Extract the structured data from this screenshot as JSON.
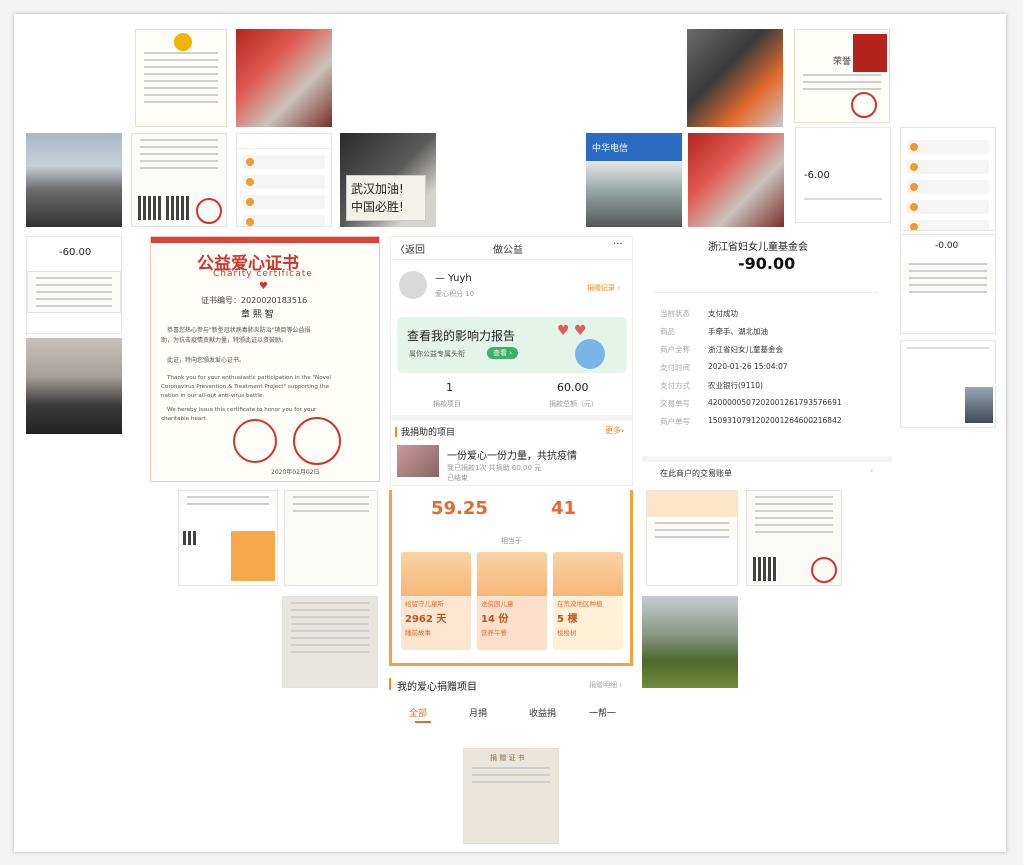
{
  "certificate": {
    "title": "公益爱心证书",
    "subtitle": "Charity certificate",
    "number": "证书编号：2020020183516",
    "name": "章 熙 智",
    "body_cn_1": "恭喜您热心参与\"新型冠状病毒肺炎防治\"项目等公益捐",
    "body_cn_2": "助，为抗击疫情贡献力量，特颁此证以资鼓励。",
    "body_cn_3": "此证，特向您颁发爱心证书。",
    "body_en_1": "Thank you for your enthusiastic participation in the \"Novel",
    "body_en_2": "Coronavirus Prevention & Treatment Project\" supporting the",
    "body_en_3": "nation in our all-out anti-virus battle.",
    "body_en_4": "We hereby issue this certificate to honor you for your",
    "body_en_5": "charitable heart.",
    "date": "2020年02月02日"
  },
  "app": {
    "back_label": "返回",
    "title": "做公益",
    "more": "···",
    "user_name": "— Yuyh",
    "user_sub": "爱心积分 10",
    "user_link": "捐赠记录",
    "banner_title": "查看我的影响力报告",
    "banner_sub": "属你公益专属头衔",
    "banner_btn": "查看",
    "stat1_value": "1",
    "stat1_label": "捐款项目",
    "stat2_value": "60.00",
    "stat2_label": "捐款总额（元）",
    "section_title": "我捐助的项目",
    "section_more": "更多",
    "project_title": "一份爱心一份力量，共抗疫情",
    "project_sub1": "我已捐款1次 共捐助 60.00 元",
    "project_sub2": "已结束"
  },
  "payment": {
    "merchant": "浙江省妇女儿童基金会",
    "amount": "-90.00",
    "rows": [
      {
        "label": "当前状态",
        "value": "支付成功"
      },
      {
        "label": "商品",
        "value": "手牵手、湖北加油"
      },
      {
        "label": "商户全称",
        "value": "浙江省妇女儿童基金会"
      },
      {
        "label": "支付时间",
        "value": "2020-01-26 15:04:07"
      },
      {
        "label": "支付方式",
        "value": "农业银行(9110)"
      },
      {
        "label": "交易单号",
        "value": "4200000507202001261793576691"
      },
      {
        "label": "商户单号",
        "value": "1509310791202001264600216842"
      }
    ],
    "footer_link": "在此商户的交易账单"
  },
  "impact": {
    "value1": "59.25",
    "value2": "41",
    "caption": "相当于",
    "cards": [
      {
        "label": "给留守儿童听",
        "value": "2962 天",
        "sub": "睡前故事"
      },
      {
        "label": "送贫困儿童",
        "value": "14 份",
        "sub": "营养午餐"
      },
      {
        "label": "在荒漠地区种植",
        "value": "5 棵",
        "sub": "梭梭树"
      }
    ],
    "list_title": "我的爱心捐赠项目",
    "list_link": "捐赠明细",
    "tabs": [
      "全部",
      "月捐",
      "收益捐",
      "一帮一"
    ]
  },
  "small_receipt": {
    "amount_left": "-60.00",
    "amount_right": "-6.00",
    "amount_far_right": "-0.00"
  },
  "misc": {
    "donation_cert_title": "捐 赠 证 书",
    "honor_title": "荣誉",
    "sign_line1": "武汉加油!",
    "sign_line2": "中国必胜!",
    "store_sign": "中华电信"
  },
  "colors": {
    "accent": "#f08a1c",
    "red": "#d2342b",
    "green": "#3fae6b"
  }
}
